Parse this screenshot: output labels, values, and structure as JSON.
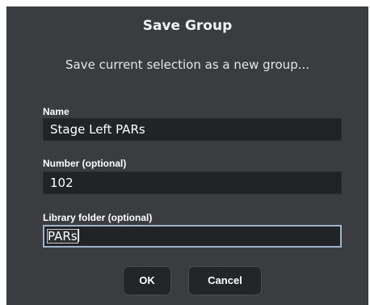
{
  "dialog": {
    "title": "Save Group",
    "subtitle": "Save current selection as a new group..."
  },
  "fields": {
    "name": {
      "label": "Name",
      "value": "Stage Left PARs"
    },
    "number": {
      "label": "Number (optional)",
      "value": "102"
    },
    "folder": {
      "label": "Library folder (optional)",
      "value": "PARs"
    }
  },
  "buttons": {
    "ok": "OK",
    "cancel": "Cancel"
  },
  "colors": {
    "dialog_bg": "#3b3c40",
    "input_bg": "#222326",
    "focus_border": "#9db3cf"
  }
}
